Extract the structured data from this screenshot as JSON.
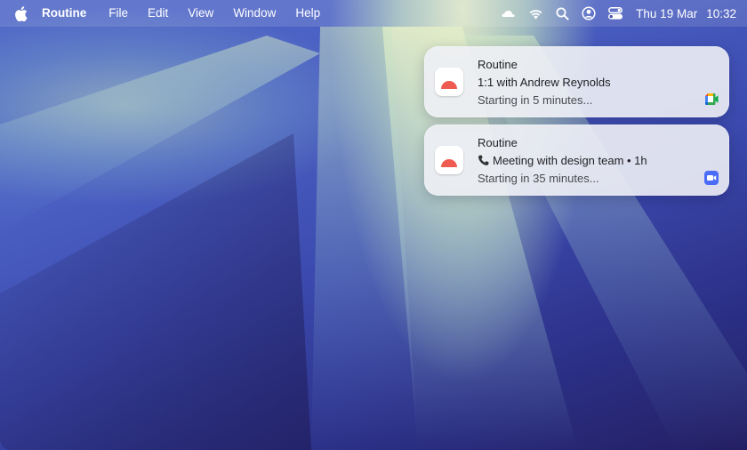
{
  "menubar": {
    "app_name": "Routine",
    "items": [
      "File",
      "Edit",
      "View",
      "Window",
      "Help"
    ],
    "date": "Thu 19 Mar",
    "time": "10:32",
    "tray_icons": [
      "cloud-icon",
      "wifi-icon",
      "search-icon",
      "user-account-icon",
      "control-center-icon"
    ]
  },
  "notifications": [
    {
      "app": "Routine",
      "title": "1:1 with Andrew Reynolds",
      "subtitle": "Starting in 5 minutes...",
      "badge_icon": "google-meet-icon"
    },
    {
      "app": "Routine",
      "title": "Meeting with design team • 1h",
      "title_icon": "phone-icon",
      "subtitle": "Starting in 35 minutes...",
      "badge_icon": "zoom-icon"
    }
  ],
  "colors": {
    "routine_accent": "#ef5b50",
    "zoom_blue": "#4a6cf7"
  }
}
